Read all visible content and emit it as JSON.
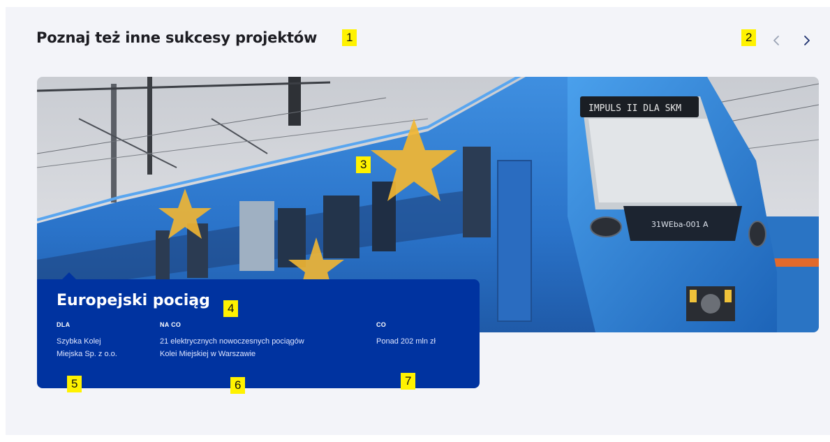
{
  "section": {
    "title": "Poznaj też inne sukcesy projektów"
  },
  "carousel": {
    "prev_icon": "chevron-left-icon",
    "next_icon": "chevron-right-icon"
  },
  "slide": {
    "image_alt_icon": "train-photo",
    "destination_board": "IMPULS II DLA SKM",
    "unit_number": "31WEba-001 A",
    "title": "Europejski pociąg",
    "columns": [
      {
        "label": "DLA",
        "value": "Szybka Kolej\nMiejska Sp. z o.o."
      },
      {
        "label": "NA CO",
        "value": "21 elektrycznych nowoczesnych pociągów\nKolei Miejskiej w Warszawie"
      },
      {
        "label": "CO",
        "value": "Ponad 202 mln zł"
      }
    ]
  },
  "markers": [
    "1",
    "2",
    "3",
    "4",
    "5",
    "6",
    "7"
  ],
  "colors": {
    "card_blue": "#0033a0",
    "train_blue": "#2a7fd4",
    "eu_star": "#f2b632",
    "marker_yellow": "#fff200"
  }
}
